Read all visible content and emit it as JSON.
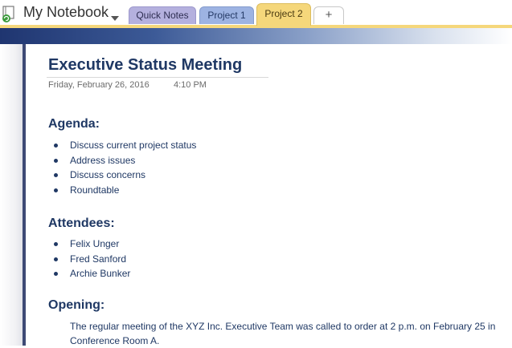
{
  "notebook": {
    "name": "My Notebook"
  },
  "tabs": [
    {
      "label": "Quick Notes",
      "color": "#b4b0de"
    },
    {
      "label": "Project 1",
      "color": "#9db3e2"
    },
    {
      "label": "Project 2",
      "color": "#f5d77b",
      "active": true
    },
    {
      "label": "+"
    }
  ],
  "page": {
    "title": "Executive Status Meeting",
    "date": "Friday, February 26, 2016",
    "time": "4:10 PM"
  },
  "sections": {
    "agenda": {
      "heading": "Agenda:",
      "items": [
        "Discuss current project status",
        "Address issues",
        "Discuss concerns",
        "Roundtable"
      ]
    },
    "attendees": {
      "heading": "Attendees:",
      "items": [
        "Felix Unger",
        "Fred Sanford",
        "Archie Bunker"
      ]
    },
    "opening": {
      "heading": "Opening:",
      "text": "The regular meeting of the XYZ Inc. Executive Team was called to order at 2 p.m. on February 25 in Conference Room A."
    }
  },
  "colors": {
    "heading_blue": "#1f3864",
    "active_tab": "#f5d77b"
  },
  "icons": {
    "notebook": "notebook-sync-icon",
    "dropdown": "chevron-down-icon"
  }
}
